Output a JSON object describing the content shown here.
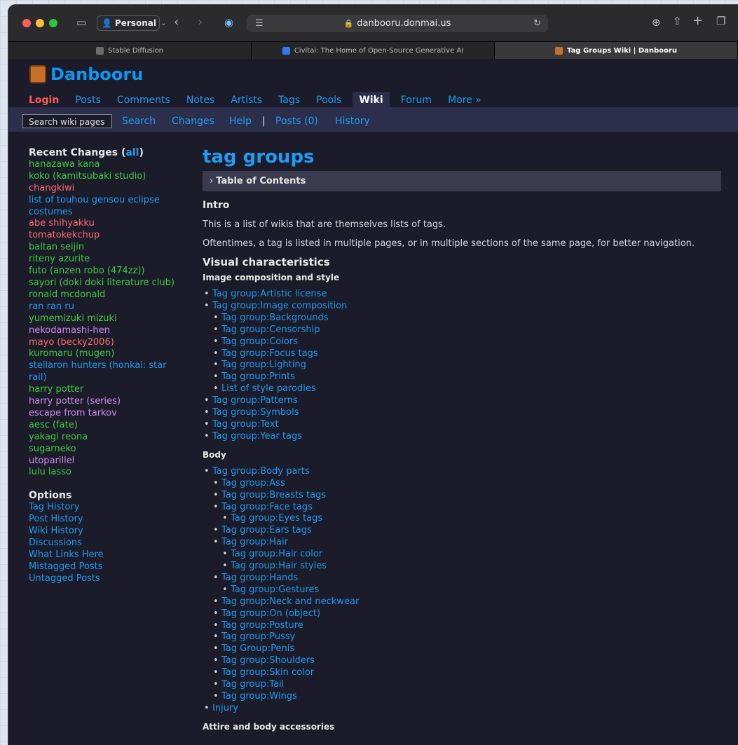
{
  "browser": {
    "profile": "Personal",
    "url": "danbooru.donmai.us",
    "tabs": [
      {
        "label": "Stable Diffusion",
        "fav": "#6b6b6b"
      },
      {
        "label": "Civitai: The Home of Open-Source Generative AI",
        "fav": "#2d7bf0"
      },
      {
        "label": "Tag Groups Wiki | Danbooru",
        "fav": "#c86f2a"
      }
    ]
  },
  "site": {
    "logo": "Danbooru",
    "nav": [
      "Login",
      "Posts",
      "Comments",
      "Notes",
      "Artists",
      "Tags",
      "Pools",
      "Wiki",
      "Forum",
      "More »"
    ],
    "subnav": {
      "search": "Search wiki pages",
      "links": [
        "Search",
        "Changes",
        "Help",
        "|",
        "Posts (0)",
        "History"
      ]
    }
  },
  "sidebar": {
    "recent_title": "Recent Changes (",
    "recent_all": "all",
    "recent_close": ")",
    "recent": [
      {
        "t": "hanazawa kana",
        "c": "g"
      },
      {
        "t": "koko (kamitsubaki studio)",
        "c": "g"
      },
      {
        "t": "changkiwi",
        "c": "r"
      },
      {
        "t": "list of touhou gensou eclipse",
        "c": "b"
      },
      {
        "t": "costumes",
        "c": "b"
      },
      {
        "t": "abe shihyakku",
        "c": "r"
      },
      {
        "t": "tomatokekchup",
        "c": "r"
      },
      {
        "t": "baltan seijin",
        "c": "g"
      },
      {
        "t": "riteny azurite",
        "c": "g"
      },
      {
        "t": "futo (anzen robo (474zz))",
        "c": "g"
      },
      {
        "t": "sayori (doki doki literature club)",
        "c": "g"
      },
      {
        "t": "ronald mcdonald",
        "c": "g"
      },
      {
        "t": "ran ran ru",
        "c": "b"
      },
      {
        "t": "yumemizuki mizuki",
        "c": "g"
      },
      {
        "t": "nekodamashi-hen",
        "c": "p"
      },
      {
        "t": "mayo (becky2006)",
        "c": "r"
      },
      {
        "t": "kuromaru (mugen)",
        "c": "g"
      },
      {
        "t": "stellaron hunters (honkai: star",
        "c": "b"
      },
      {
        "t": "rail)",
        "c": "b"
      },
      {
        "t": "harry potter",
        "c": "g"
      },
      {
        "t": "harry potter (series)",
        "c": "p"
      },
      {
        "t": "escape from tarkov",
        "c": "p"
      },
      {
        "t": "aesc (fate)",
        "c": "g"
      },
      {
        "t": "yakagi reona",
        "c": "g"
      },
      {
        "t": "sugarneko",
        "c": "g"
      },
      {
        "t": "utoparillel",
        "c": "p"
      },
      {
        "t": "lulu lasso",
        "c": "g"
      }
    ],
    "options_title": "Options",
    "options": [
      "Tag History",
      "Post History",
      "Wiki History",
      "Discussions",
      "What Links Here",
      "Mistagged Posts",
      "Untagged Posts"
    ]
  },
  "content": {
    "title": "tag groups",
    "toc": "Table of Contents",
    "intro_heading": "Intro",
    "intro_p1": "This is a list of wikis that are themselves lists of tags.",
    "intro_p2": "Oftentimes, a tag is listed in multiple pages, or in multiple sections of the same page, for better navigation.",
    "visual_heading": "Visual characteristics",
    "image_comp_heading": "Image composition and style",
    "image_comp": [
      {
        "t": "Tag group:Artistic license",
        "l": 0
      },
      {
        "t": "Tag group:Image composition",
        "l": 0
      },
      {
        "t": "Tag group:Backgrounds",
        "l": 1
      },
      {
        "t": "Tag group:Censorship",
        "l": 1
      },
      {
        "t": "Tag group:Colors",
        "l": 1
      },
      {
        "t": "Tag group:Focus tags",
        "l": 1
      },
      {
        "t": "Tag group:Lighting",
        "l": 1
      },
      {
        "t": "Tag group:Prints",
        "l": 1
      },
      {
        "t": "List of style parodies",
        "l": 1
      },
      {
        "t": "Tag group:Patterns",
        "l": 0
      },
      {
        "t": "Tag group:Symbols",
        "l": 0
      },
      {
        "t": "Tag group:Text",
        "l": 0
      },
      {
        "t": "Tag group:Year tags",
        "l": 0
      }
    ],
    "body_heading": "Body",
    "body": [
      {
        "t": "Tag group:Body parts",
        "l": 0
      },
      {
        "t": "Tag group:Ass",
        "l": 1
      },
      {
        "t": "Tag group:Breasts tags",
        "l": 1
      },
      {
        "t": "Tag group:Face tags",
        "l": 1
      },
      {
        "t": "Tag group:Eyes tags",
        "l": 2
      },
      {
        "t": "Tag group:Ears tags",
        "l": 1
      },
      {
        "t": "Tag group:Hair",
        "l": 1
      },
      {
        "t": "Tag group:Hair color",
        "l": 2
      },
      {
        "t": "Tag group:Hair styles",
        "l": 2
      },
      {
        "t": "Tag group:Hands",
        "l": 1
      },
      {
        "t": "Tag group:Gestures",
        "l": 2
      },
      {
        "t": "Tag group:Neck and neckwear",
        "l": 1
      },
      {
        "t": "Tag group:On (object)",
        "l": 1
      },
      {
        "t": "Tag group:Posture",
        "l": 1
      },
      {
        "t": "Tag group:Pussy",
        "l": 1
      },
      {
        "t": "Tag Group:Penis",
        "l": 1
      },
      {
        "t": "Tag group:Shoulders",
        "l": 1
      },
      {
        "t": "Tag group:Skin color",
        "l": 1
      },
      {
        "t": "Tag group:Tail",
        "l": 1
      },
      {
        "t": "Tag group:Wings",
        "l": 1
      },
      {
        "t": "Injury",
        "l": 0
      }
    ],
    "attire_heading": "Attire and body accessories"
  }
}
